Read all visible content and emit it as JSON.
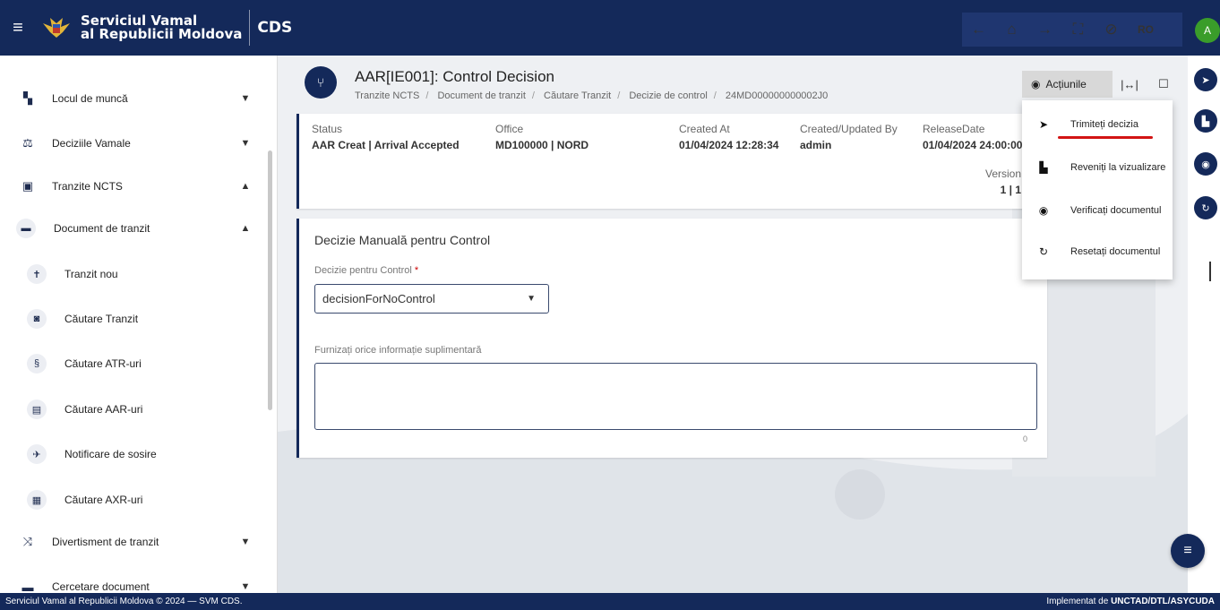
{
  "topbar": {
    "brand_line1": "Serviciul Vamal",
    "brand_line2": "al Republicii Moldova",
    "app_name": "CDS",
    "lang": "RO",
    "avatar_initial": "A",
    "icons": [
      "menu-icon",
      "arrow-left-icon",
      "home-icon",
      "arrow-right-icon",
      "fullscreen-icon",
      "notifications-off-icon"
    ]
  },
  "sidebar": {
    "items": [
      {
        "label": "Locul de muncă",
        "icon": "dashboard-icon"
      },
      {
        "label": "Deciziile Vamale",
        "icon": "scale-icon"
      },
      {
        "label": "Tranzite NCTS",
        "icon": "bus-icon"
      },
      {
        "label": "Document de tranzit",
        "icon": "truck-icon"
      },
      {
        "label": "Tranzit nou",
        "icon": "signpost-icon"
      },
      {
        "label": "Căutare Tranzit",
        "icon": "search-doc-icon"
      },
      {
        "label": "Căutare ATR-uri",
        "icon": "route-icon"
      },
      {
        "label": "Căutare AAR-uri",
        "icon": "find-doc-icon"
      },
      {
        "label": "Notificare de sosire",
        "icon": "arrival-icon"
      },
      {
        "label": "Căutare AXR-uri",
        "icon": "search-cargo-icon"
      },
      {
        "label": "Divertisment de tranzit",
        "icon": "shuffle-icon"
      },
      {
        "label": "Cercetare document",
        "icon": "comment-icon"
      }
    ]
  },
  "page": {
    "title": "AAR[IE001]: Control Decision",
    "breadcrumb": [
      "Tranzite NCTS",
      "Document de tranzit",
      "Căutare Tranzit",
      "Decizie de control",
      "24MD000000000002J0"
    ]
  },
  "info": {
    "status_label": "Status",
    "status_value": "AAR Creat | Arrival Accepted",
    "office_label": "Office",
    "office_value": "MD100000 | NORD",
    "created_label": "Created At",
    "created_value": "01/04/2024 12:28:34",
    "by_label": "Created/Updated By",
    "by_value": "admin",
    "release_label": "ReleaseDate",
    "release_value": "01/04/2024 24:00:00",
    "version_label": "Version",
    "version_value": "1 | 1"
  },
  "form": {
    "title": "Decizie Manuală pentru Control",
    "decision_label": "Decizie pentru Control",
    "decision_required": "*",
    "decision_value": "decisionForNoControl",
    "extra_label": "Furnizați orice informație suplimentară",
    "extra_value": "",
    "counter": "0"
  },
  "actions": {
    "button_label": "Acțiunile",
    "menu": [
      {
        "label": "Trimiteți decizia",
        "icon": "send-icon"
      },
      {
        "label": "Reveniți la vizualizare",
        "icon": "document-icon"
      },
      {
        "label": "Verificați documentul",
        "icon": "eye-icon"
      },
      {
        "label": "Resetați documentul",
        "icon": "reset-icon"
      }
    ]
  },
  "footer": {
    "left": "Serviciul Vamal al Republicii Moldova © 2024 — SVM CDS.",
    "right_prefix": "Implementat de",
    "right_bold": "UNCTAD/DTL/ASYCUDA"
  },
  "colors": {
    "primary": "#14295a",
    "accent_red": "#d21414",
    "avatar": "#3a9d2a"
  }
}
